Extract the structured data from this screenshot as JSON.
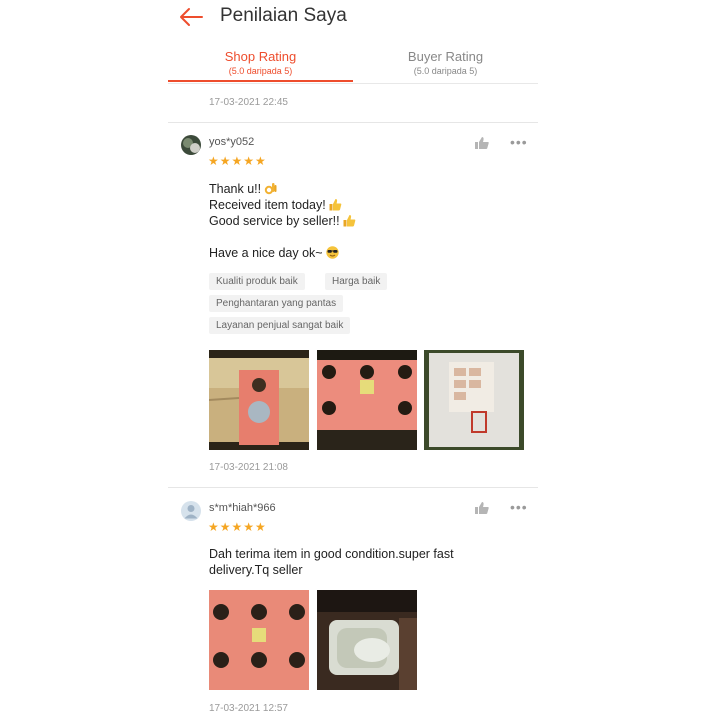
{
  "header": {
    "title": "Penilaian Saya"
  },
  "tabs": [
    {
      "label": "Shop Rating",
      "sublabel": "(5.0 daripada 5)"
    },
    {
      "label": "Buyer Rating",
      "sublabel": "(5.0 daripada 5)"
    }
  ],
  "top_timestamp": "17-03-2021 22:45",
  "reviews": [
    {
      "username": "yos*y052",
      "stars": "★★★★★",
      "comment_lines": [
        "Thank u!!",
        "Received item today!",
        "Good service by seller!!",
        "Have a nice day ok~"
      ],
      "emoji_icons": [
        "ok-hand-icon",
        "thumbs-up-icon",
        "thumbs-up-icon",
        "sunglasses-face-icon"
      ],
      "tags": [
        "Kualiti produk baik",
        "Harga baik",
        "Penghantaran yang pantas",
        "Layanan penjual sangat baik"
      ],
      "photo_count": 3,
      "timestamp": "17-03-2021 21:08"
    },
    {
      "username": "s*m*hiah*966",
      "stars": "★★★★★",
      "comment_lines": [
        "Dah terima item in good condition.super fast",
        "delivery.Tq seller"
      ],
      "photo_count": 2,
      "timestamp": "17-03-2021 12:57"
    }
  ],
  "colors": {
    "accent": "#ee4d2d",
    "star": "#f5a623",
    "tag_bg": "#f2f2f2"
  }
}
